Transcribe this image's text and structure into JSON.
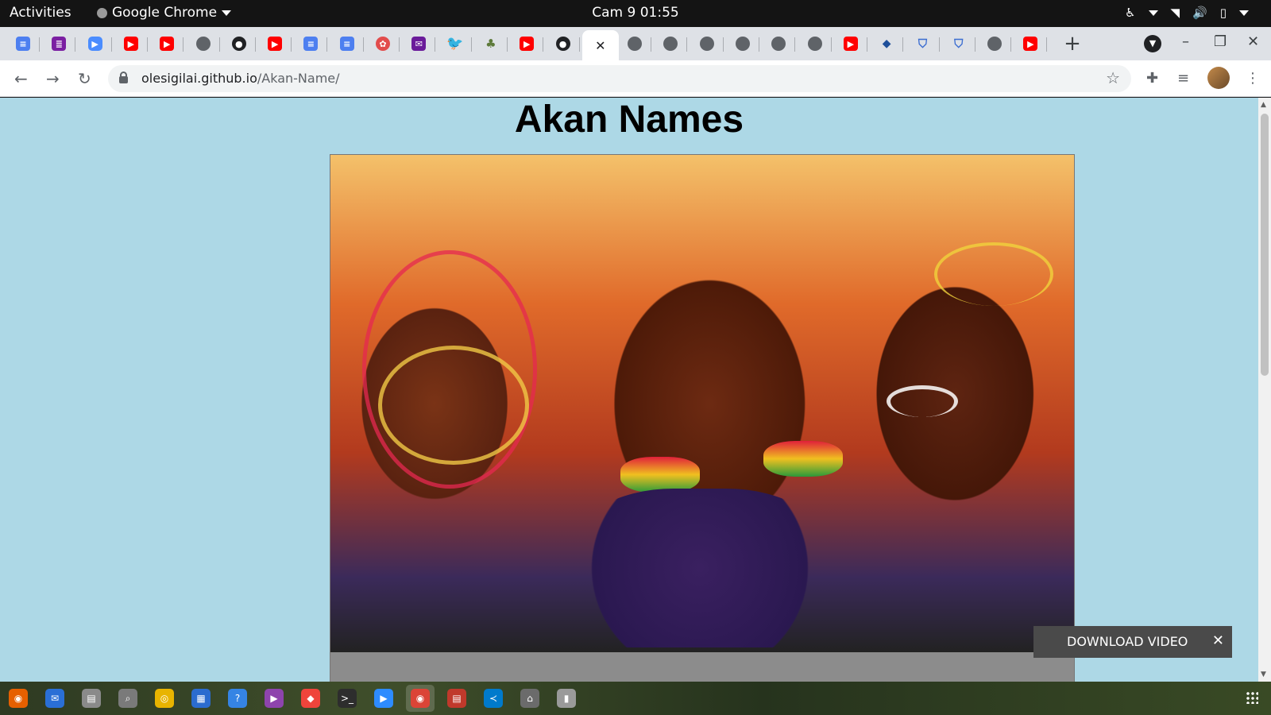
{
  "topbar": {
    "activities": "Activities",
    "app_name": "Google Chrome",
    "clock": "Cam 9  01:55"
  },
  "tabs": [
    {
      "icon": "docs-icon",
      "kind": "docs",
      "glyph": "≡"
    },
    {
      "icon": "sheets-icon",
      "kind": "sheets",
      "glyph": "≣"
    },
    {
      "icon": "zoom-icon",
      "kind": "zoom",
      "glyph": "▶"
    },
    {
      "icon": "youtube-icon",
      "kind": "yt",
      "glyph": "▶"
    },
    {
      "icon": "youtube-icon",
      "kind": "yt",
      "glyph": "▶"
    },
    {
      "icon": "globe-icon",
      "kind": "globe",
      "glyph": ""
    },
    {
      "icon": "github-icon",
      "kind": "gh",
      "glyph": "●"
    },
    {
      "icon": "youtube-icon",
      "kind": "yt",
      "glyph": "▶"
    },
    {
      "icon": "docs-icon",
      "kind": "docs",
      "glyph": "≡"
    },
    {
      "icon": "docs-icon",
      "kind": "docs",
      "glyph": "≡"
    },
    {
      "icon": "openai-icon",
      "kind": "ai",
      "glyph": "✿"
    },
    {
      "icon": "mail-icon",
      "kind": "mail",
      "glyph": "✉"
    },
    {
      "icon": "twitter-icon",
      "kind": "tw",
      "glyph": "🐦"
    },
    {
      "icon": "tree-icon",
      "kind": "tree",
      "glyph": "♣"
    },
    {
      "icon": "youtube-icon",
      "kind": "yt",
      "glyph": "▶"
    },
    {
      "icon": "github-icon",
      "kind": "gh",
      "glyph": "●"
    },
    {
      "icon": "active-tab-close-icon",
      "kind": "active",
      "glyph": "✕"
    },
    {
      "icon": "globe-icon",
      "kind": "globe",
      "glyph": ""
    },
    {
      "icon": "globe-icon",
      "kind": "globe",
      "glyph": ""
    },
    {
      "icon": "globe-icon",
      "kind": "globe",
      "glyph": ""
    },
    {
      "icon": "globe-icon",
      "kind": "globe",
      "glyph": ""
    },
    {
      "icon": "globe-icon",
      "kind": "globe",
      "glyph": ""
    },
    {
      "icon": "globe-icon",
      "kind": "globe",
      "glyph": ""
    },
    {
      "icon": "youtube-icon",
      "kind": "yt",
      "glyph": "▶"
    },
    {
      "icon": "graduation-cap-icon",
      "kind": "cap",
      "glyph": "◆"
    },
    {
      "icon": "cloudtech-icon",
      "kind": "ct",
      "glyph": "⛉"
    },
    {
      "icon": "cloudtech-icon",
      "kind": "ct",
      "glyph": "⛉"
    },
    {
      "icon": "globe-icon",
      "kind": "globe",
      "glyph": ""
    },
    {
      "icon": "youtube-icon",
      "kind": "yt",
      "glyph": "▶"
    }
  ],
  "address_bar": {
    "host": "olesigilai.github.io",
    "path": "/Akan-Name/"
  },
  "page": {
    "title": "Akan Names"
  },
  "overlay": {
    "download_label": "DOWNLOAD VIDEO",
    "close": "✕"
  },
  "taskbar": [
    {
      "name": "firefox-icon",
      "color": "#e66000",
      "glyph": "◉"
    },
    {
      "name": "thunderbird-icon",
      "color": "#2a6fd6",
      "glyph": "✉"
    },
    {
      "name": "files-icon",
      "color": "#8a8a8a",
      "glyph": "▤"
    },
    {
      "name": "screenshot-icon",
      "color": "#7a7a7a",
      "glyph": "⌕"
    },
    {
      "name": "rhythmbox-icon",
      "color": "#e8b400",
      "glyph": "◎"
    },
    {
      "name": "writer-icon",
      "color": "#2b6ccf",
      "glyph": "▦"
    },
    {
      "name": "help-icon",
      "color": "#3584e4",
      "glyph": "?"
    },
    {
      "name": "video-icon",
      "color": "#8e44ad",
      "glyph": "▶"
    },
    {
      "name": "anydesk-icon",
      "color": "#ef443b",
      "glyph": "◆"
    },
    {
      "name": "terminal-icon",
      "color": "#2d2d2d",
      "glyph": ">_"
    },
    {
      "name": "zoom-icon",
      "color": "#2d8cff",
      "glyph": "▶"
    },
    {
      "name": "chrome-icon",
      "color": "#db4437",
      "glyph": "◉",
      "active": true
    },
    {
      "name": "document-viewer-icon",
      "color": "#c0392b",
      "glyph": "▤"
    },
    {
      "name": "vscode-icon",
      "color": "#007acc",
      "glyph": "≺"
    },
    {
      "name": "usb-icon",
      "color": "#6b6b6b",
      "glyph": "⌂"
    },
    {
      "name": "drive-icon",
      "color": "#9a9a9a",
      "glyph": "▮"
    }
  ]
}
